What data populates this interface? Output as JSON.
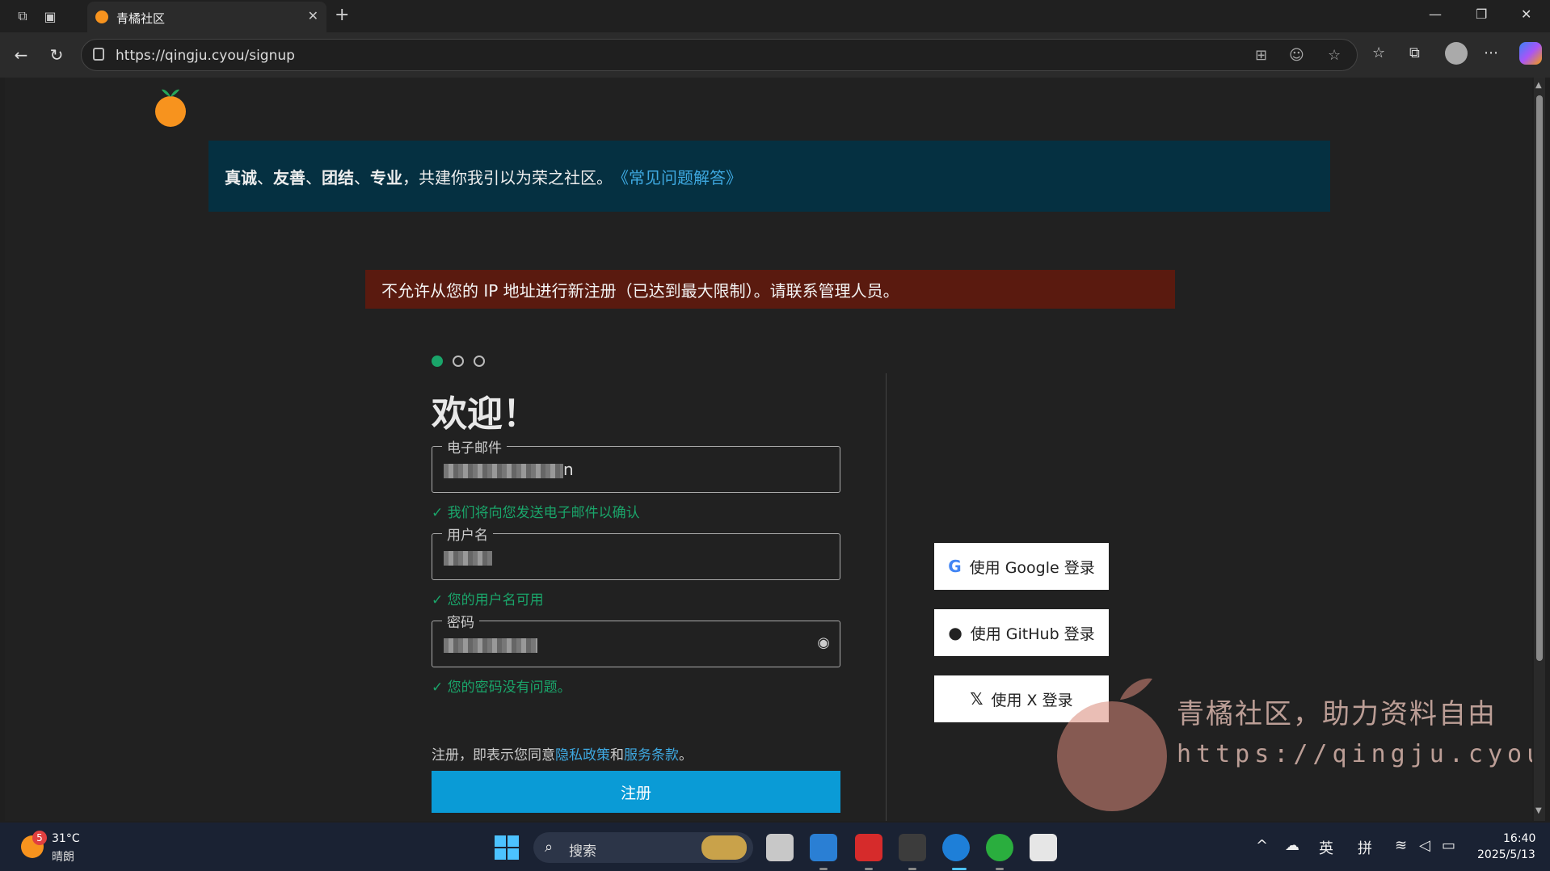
{
  "browser": {
    "tab_title": "青橘社区",
    "url": "https://qingju.cyou/signup"
  },
  "notice": {
    "bold_words": [
      "真诚",
      "友善",
      "团结",
      "专业"
    ],
    "separator": "、",
    "text": "，共建你我引以为荣之社区。",
    "link": "《常见问题解答》"
  },
  "error_message": "不允许从您的 IP 地址进行新注册（已达到最大限制）。请联系管理人员。",
  "steps": {
    "total": 3,
    "current": 1
  },
  "form": {
    "title": "欢迎！",
    "email": {
      "label": "电子邮件",
      "value_suffix": "n",
      "hint": "我们将向您发送电子邮件以确认"
    },
    "username": {
      "label": "用户名",
      "hint": "您的用户名可用"
    },
    "password": {
      "label": "密码",
      "hint": "您的密码没有问题。"
    },
    "terms_prefix": "注册，即表示您同意",
    "privacy_link": "隐私政策",
    "terms_and": "和",
    "terms_link": "服务条款",
    "terms_suffix": "。",
    "submit_label": "注册"
  },
  "social": {
    "google": "使用 Google 登录",
    "github": "使用 GitHub 登录",
    "x": "使用 X 登录"
  },
  "watermark": {
    "line1": "青橘社区，助力资料自由",
    "line2": "https://qingju.cyou"
  },
  "taskbar": {
    "weather_temp": "31°C",
    "weather_desc": "晴朗",
    "weather_badge": "5",
    "search_placeholder": "搜索",
    "ime_lang": "英",
    "ime_mode": "拼",
    "time": "16:40",
    "date": "2025/5/13"
  },
  "colors": {
    "accent": "#0a9bd6",
    "success": "#1aa56a",
    "error_bg": "#5a1a0f",
    "notice_bg": "#053041",
    "brand_orange": "#f7931e"
  }
}
